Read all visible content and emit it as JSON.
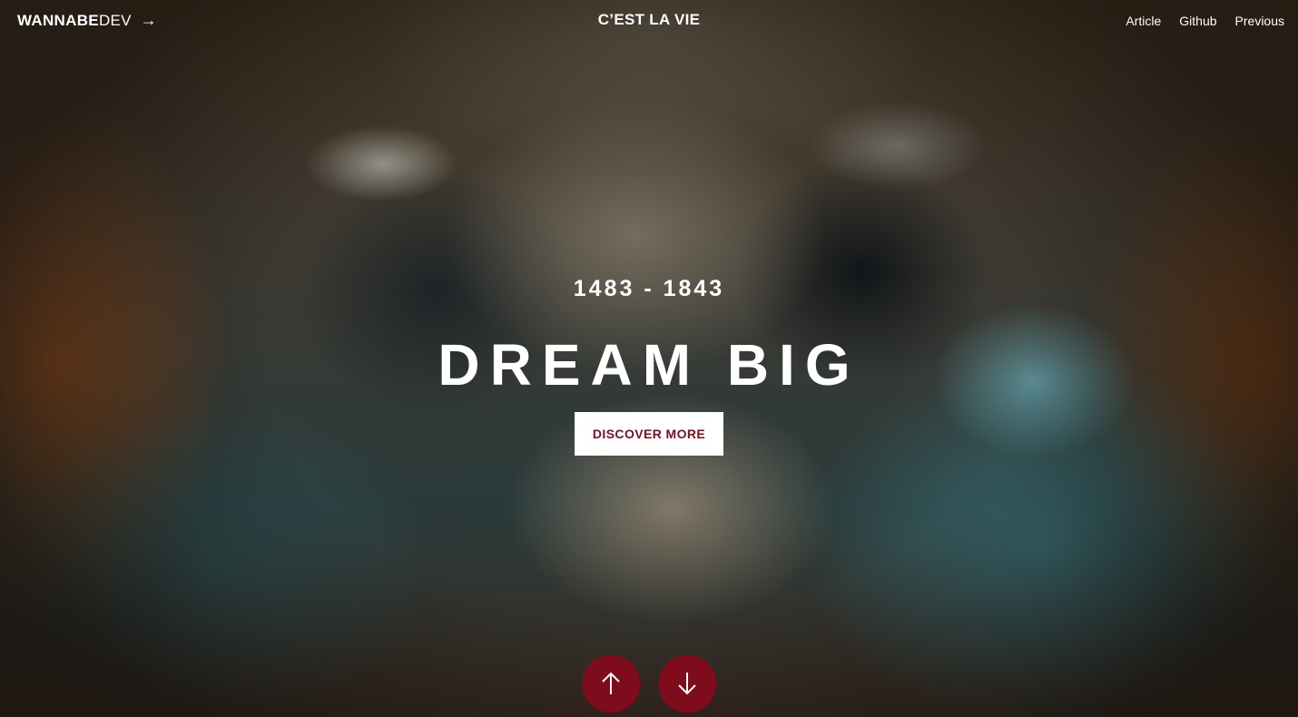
{
  "header": {
    "brand_bold": "WANNABE",
    "brand_light": "DEV",
    "brand_arrow": "→",
    "site_title": "C’EST LA VIE",
    "nav": [
      "Article",
      "Github",
      "Previous"
    ]
  },
  "hero": {
    "years": "1483 - 1843",
    "headline": "DREAM BIG",
    "cta_label": "DISCOVER MORE"
  },
  "slide_nav": {
    "up_icon": "arrow-up-icon",
    "down_icon": "arrow-down-icon"
  },
  "colors": {
    "accent": "#7e0c1c",
    "cta_text": "#7a1020",
    "text": "#ffffff"
  }
}
